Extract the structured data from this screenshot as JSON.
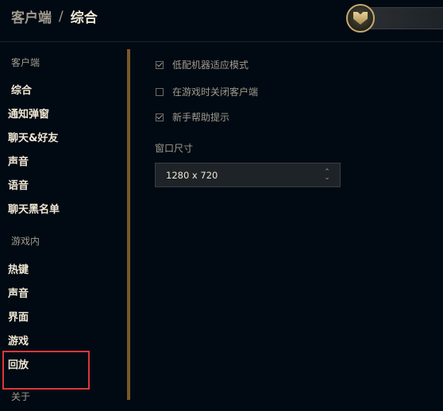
{
  "header": {
    "breadcrumb_parent": "客户端",
    "breadcrumb_separator": "/",
    "breadcrumb_current": "综合"
  },
  "sidebar": {
    "client_section": "客户端",
    "client_items": [
      "综合",
      "通知弹窗",
      "聊天&好友",
      "声音",
      "语音",
      "聊天黑名单"
    ],
    "ingame_section": "游戏内",
    "ingame_items": [
      "热键",
      "声音",
      "界面",
      "游戏",
      "回放"
    ],
    "about": "关于"
  },
  "options": [
    {
      "label": "低配机器适应模式",
      "checked": true
    },
    {
      "label": "在游戏时关闭客户端",
      "checked": false
    },
    {
      "label": "新手帮助提示",
      "checked": true
    }
  ],
  "window_size": {
    "label": "窗口尺寸",
    "value": "1280 x 720"
  },
  "colors": {
    "gold": "#c8aa6e",
    "highlight_red": "#d9383a"
  }
}
